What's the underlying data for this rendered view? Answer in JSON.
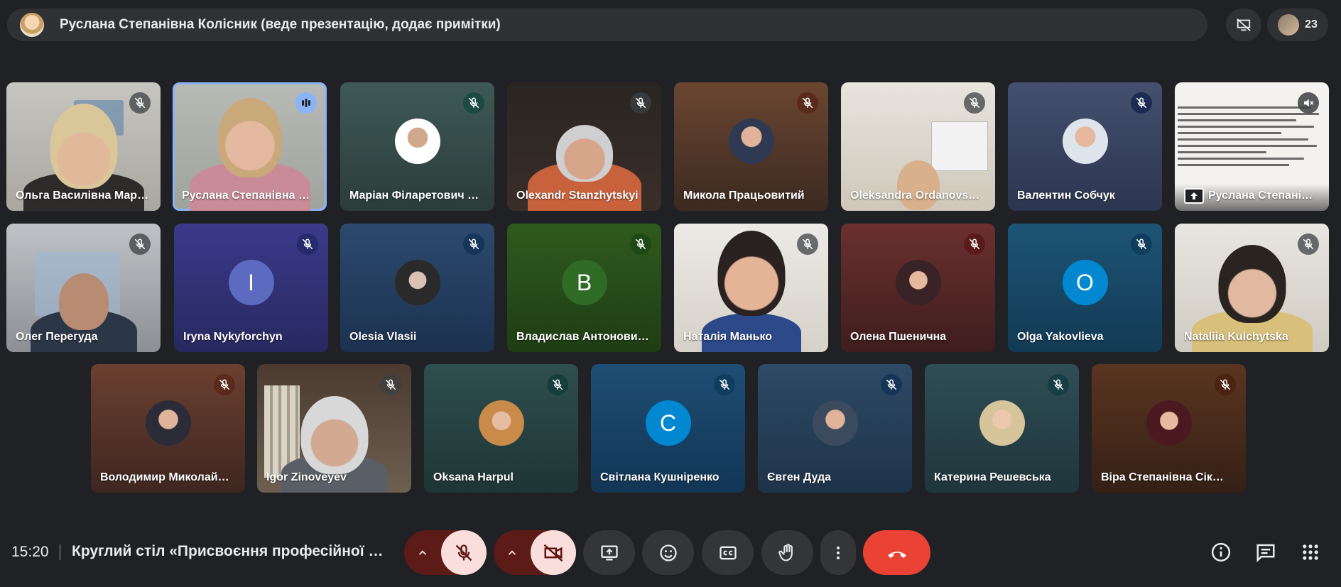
{
  "presenter_bar": {
    "title": "Руслана Степанівна Колісник (веде презентацію, додає примітки)",
    "participant_count": "23"
  },
  "tiles": [
    {
      "name": "Ольга Василівна Мар…",
      "mic": "muted"
    },
    {
      "name": "Руслана Степанівна …",
      "mic": "speaking"
    },
    {
      "name": "Маріан Філаретович …",
      "mic": "muted"
    },
    {
      "name": "Olexandr Stanzhytskyi",
      "mic": "muted"
    },
    {
      "name": "Микола Працьовитий",
      "mic": "muted"
    },
    {
      "name": "Oleksandra Ordanovs…",
      "mic": "muted"
    },
    {
      "name": "Валентин Собчук",
      "mic": "muted"
    },
    {
      "name": "Руслана Степані…",
      "mic": "muted"
    },
    {
      "name": "Олег Перегуда",
      "mic": "muted"
    },
    {
      "name": "Iryna Nykyforchyn",
      "initial": "I",
      "mic": "muted"
    },
    {
      "name": "Olesia Vlasii",
      "mic": "muted"
    },
    {
      "name": "Владислав Антонови…",
      "initial": "В",
      "mic": "muted"
    },
    {
      "name": "Наталія Манько",
      "mic": "muted"
    },
    {
      "name": "Олена Пшенична",
      "mic": "muted"
    },
    {
      "name": "Olga Yakovlieva",
      "initial": "O",
      "mic": "muted"
    },
    {
      "name": "Nataliia Kulchytska",
      "mic": "muted"
    },
    {
      "name": "Володимир Миколай…",
      "mic": "muted"
    },
    {
      "name": "Igor Zinoveyev",
      "mic": "muted"
    },
    {
      "name": "Oksana Harpul",
      "mic": "muted"
    },
    {
      "name": "Світлана Кушніренко",
      "initial": "С",
      "mic": "muted"
    },
    {
      "name": "Євген Дуда",
      "mic": "muted"
    },
    {
      "name": "Катерина Решевська",
      "mic": "muted"
    },
    {
      "name": "Віра Степанівна Сік…",
      "mic": "muted"
    }
  ],
  "bottom_bar": {
    "time": "15:20",
    "meeting_title": "Круглий стіл «Присвоєння професійної к…"
  },
  "icons": {
    "mic_off": "mic-off-icon",
    "speaking": "audio-bars-icon",
    "camera_off": "videocam-off-icon",
    "present": "present-screen-icon",
    "emoji": "emoji-icon",
    "captions": "closed-captions-icon",
    "hand": "raise-hand-icon",
    "more": "more-vert-icon",
    "hangup": "call-end-icon",
    "info": "info-icon",
    "chat": "chat-icon",
    "activities": "apps-grid-icon"
  },
  "colors": {
    "background": "#202124",
    "hangup": "#ea4335",
    "muted_control": "#f9dedc",
    "speaking_outline": "#8ab4f8"
  }
}
